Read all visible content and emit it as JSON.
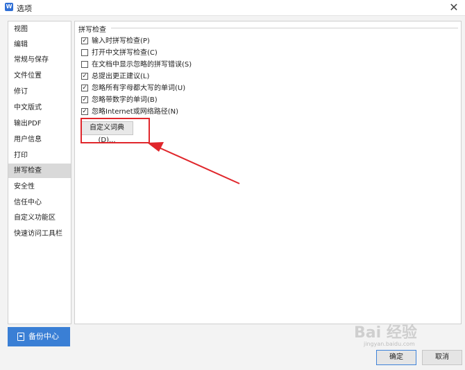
{
  "window": {
    "title": "选项",
    "icon_letter": "W",
    "close_glyph": "✕"
  },
  "sidebar": {
    "items": [
      {
        "label": "视图",
        "active": false
      },
      {
        "label": "编辑",
        "active": false
      },
      {
        "label": "常规与保存",
        "active": false
      },
      {
        "label": "文件位置",
        "active": false
      },
      {
        "label": "修订",
        "active": false
      },
      {
        "label": "中文版式",
        "active": false
      },
      {
        "label": "输出PDF",
        "active": false
      },
      {
        "label": "用户信息",
        "active": false
      },
      {
        "label": "打印",
        "active": false
      },
      {
        "label": "拼写检查",
        "active": true
      },
      {
        "label": "安全性",
        "active": false
      },
      {
        "label": "信任中心",
        "active": false
      },
      {
        "label": "自定义功能区",
        "active": false
      },
      {
        "label": "快速访问工具栏",
        "active": false
      }
    ],
    "backup_label": "备份中心"
  },
  "spell": {
    "group_title": "拼写检查",
    "options": [
      {
        "label": "输入时拼写检查(P)",
        "checked": true
      },
      {
        "label": "打开中文拼写检查(C)",
        "checked": false
      },
      {
        "label": "在文档中显示忽略的拼写错误(S)",
        "checked": false
      },
      {
        "label": "总提出更正建议(L)",
        "checked": true
      },
      {
        "label": "忽略所有字母都大写的单词(U)",
        "checked": true
      },
      {
        "label": "忽略带数字的单词(B)",
        "checked": true
      },
      {
        "label": "忽略Internet或网络路径(N)",
        "checked": true
      }
    ],
    "dict_button": "自定义词典(D)..."
  },
  "footer": {
    "ok_label": "确定",
    "cancel_label": "取消"
  },
  "watermark": {
    "main": "Bai 经验",
    "sub": "jingyan.baidu.com"
  },
  "colors": {
    "accent": "#3a7fd5",
    "annotation": "#e0262b",
    "active_nav": "#d9d9d9"
  }
}
